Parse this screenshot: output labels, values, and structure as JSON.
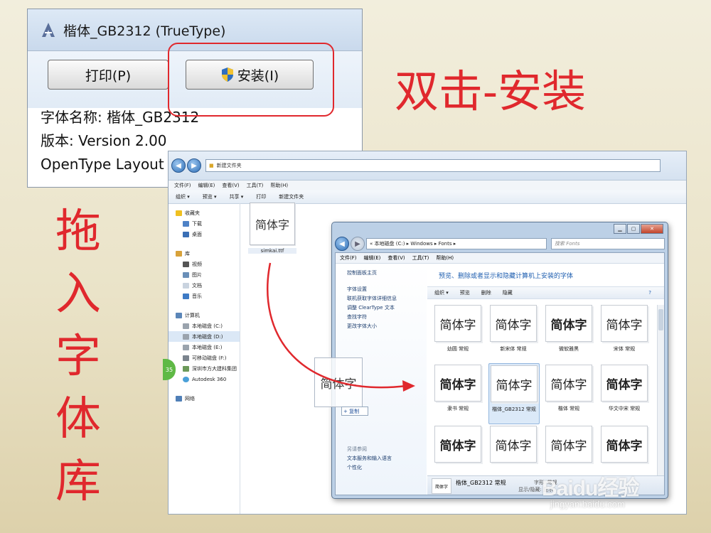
{
  "font_window": {
    "title": "楷体_GB2312 (TrueType)",
    "print_button": "打印(P)",
    "install_button": "安装(I)",
    "info_lines": [
      "字体名称: 楷体_GB2312",
      "版本: Version 2.00",
      "OpenType Layout"
    ]
  },
  "annotations": {
    "double_click_install": "双击-安装",
    "drag_into_fontlib": "拖入字体库"
  },
  "explorer": {
    "address": "新建文件夹",
    "menu": [
      "文件(F)",
      "编辑(E)",
      "查看(V)",
      "工具(T)",
      "帮助(H)"
    ],
    "commands": [
      "组织 ▾",
      "预览 ▾",
      "共享 ▾",
      "打印",
      "新建文件夹"
    ],
    "nav": {
      "favorites": "收藏夹",
      "favorites_items": [
        "下载",
        "桌面"
      ],
      "libraries": "库",
      "libraries_items": [
        "视频",
        "图片",
        "文档",
        "音乐"
      ],
      "computer": "计算机",
      "computer_items": [
        "本地磁盘 (C:)",
        "本地磁盘 (D:)",
        "本地磁盘 (E:)",
        "可移动磁盘 (F:)",
        "深圳市方大建科集团",
        "Autodesk 360"
      ],
      "network": "网络"
    },
    "file": {
      "preview": "简体字",
      "name": "simkai.ttf"
    }
  },
  "fonts_window": {
    "address": "« 本地磁盘 (C:) ▸ Windows ▸ Fonts ▸",
    "search_placeholder": "搜索 Fonts",
    "menu": [
      "文件(F)",
      "编辑(E)",
      "查看(V)",
      "工具(T)",
      "帮助(H)"
    ],
    "left_links": [
      "控制面板主页",
      "字体设置",
      "联机获取字体详细信息",
      "调整 ClearType 文本",
      "查找字符",
      "更改字体大小"
    ],
    "see_also_label": "另请参阅",
    "see_also_links": [
      "文本服务和输入语言",
      "个性化"
    ],
    "heading": "预览、删除或者显示和隐藏计算机上安装的字体",
    "commands": [
      "组织 ▾",
      "预览",
      "删除",
      "隐藏"
    ],
    "tiles": [
      {
        "preview": "简体字",
        "name": "幼圆 常规"
      },
      {
        "preview": "简体字",
        "name": "新宋体 常规"
      },
      {
        "preview": "简体字",
        "name": "微软雅黑"
      },
      {
        "preview": "简体字",
        "name": "宋体 常规"
      },
      {
        "preview": "简体字",
        "name": "隶书 常规"
      },
      {
        "preview": "简体字",
        "name": "楷体_GB2312 常规"
      },
      {
        "preview": "简体字",
        "name": "楷体 常规"
      },
      {
        "preview": "简体字",
        "name": "华文中宋 常规"
      },
      {
        "preview": "简体字",
        "name": ""
      },
      {
        "preview": "简体字",
        "name": ""
      },
      {
        "preview": "简体字",
        "name": ""
      },
      {
        "preview": "简体字",
        "name": ""
      }
    ],
    "details": {
      "preview": "简体字",
      "name": "楷体_GB2312 常规",
      "style_label": "字形: 常规",
      "visibility_label": "显示/隐藏: 显示"
    }
  },
  "drag_ghost": {
    "preview": "简体字",
    "copy_label": "+ 复制"
  },
  "watermark": {
    "logo": "Baidu经验",
    "url": "jingyan.baidu.com"
  },
  "colors": {
    "annotation_red": "#e0282d",
    "link_blue": "#1f5fb0"
  }
}
